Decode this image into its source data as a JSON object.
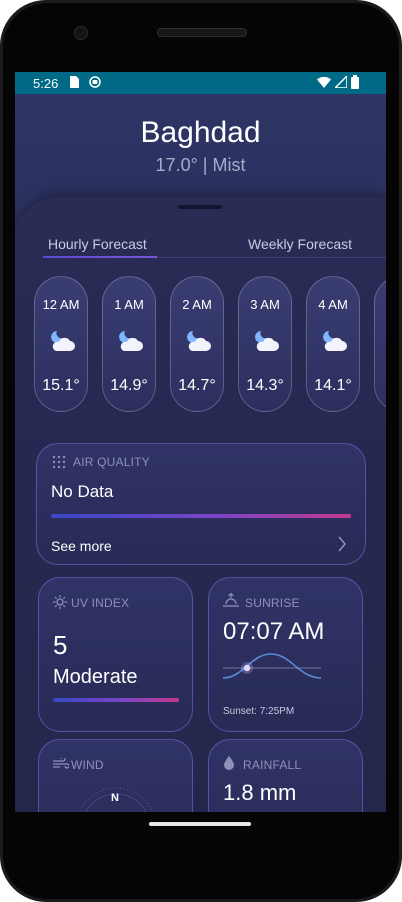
{
  "status_bar": {
    "time": "5:26"
  },
  "location": {
    "city": "Baghdad",
    "summary": "17.0° | Mist"
  },
  "tabs": [
    {
      "label": "Hourly Forecast",
      "active": true
    },
    {
      "label": "Weekly Forecast",
      "active": false
    }
  ],
  "hourly": [
    {
      "time": "12 AM",
      "temp": "15.1°",
      "icon": "moon-cloud-icon"
    },
    {
      "time": "1 AM",
      "temp": "14.9°",
      "icon": "moon-cloud-icon"
    },
    {
      "time": "2 AM",
      "temp": "14.7°",
      "icon": "moon-cloud-icon"
    },
    {
      "time": "3 AM",
      "temp": "14.3°",
      "icon": "moon-cloud-icon"
    },
    {
      "time": "4 AM",
      "temp": "14.1°",
      "icon": "moon-cloud-icon"
    }
  ],
  "air_quality": {
    "label": "AIR QUALITY",
    "value": "No Data",
    "link": "See more"
  },
  "uv_index": {
    "label": "UV INDEX",
    "value": "5",
    "level": "Moderate"
  },
  "sunrise": {
    "label": "SUNRISE",
    "time": "07:07 AM",
    "sunset": "Sunset: 7:25PM"
  },
  "wind": {
    "label": "WIND",
    "direction": "N"
  },
  "rainfall": {
    "label": "RAINFALL",
    "value": "1.8 mm"
  },
  "colors": {
    "status_bar": "#006a86",
    "background": "#2a2f5a",
    "accent": "#7a56d8"
  }
}
